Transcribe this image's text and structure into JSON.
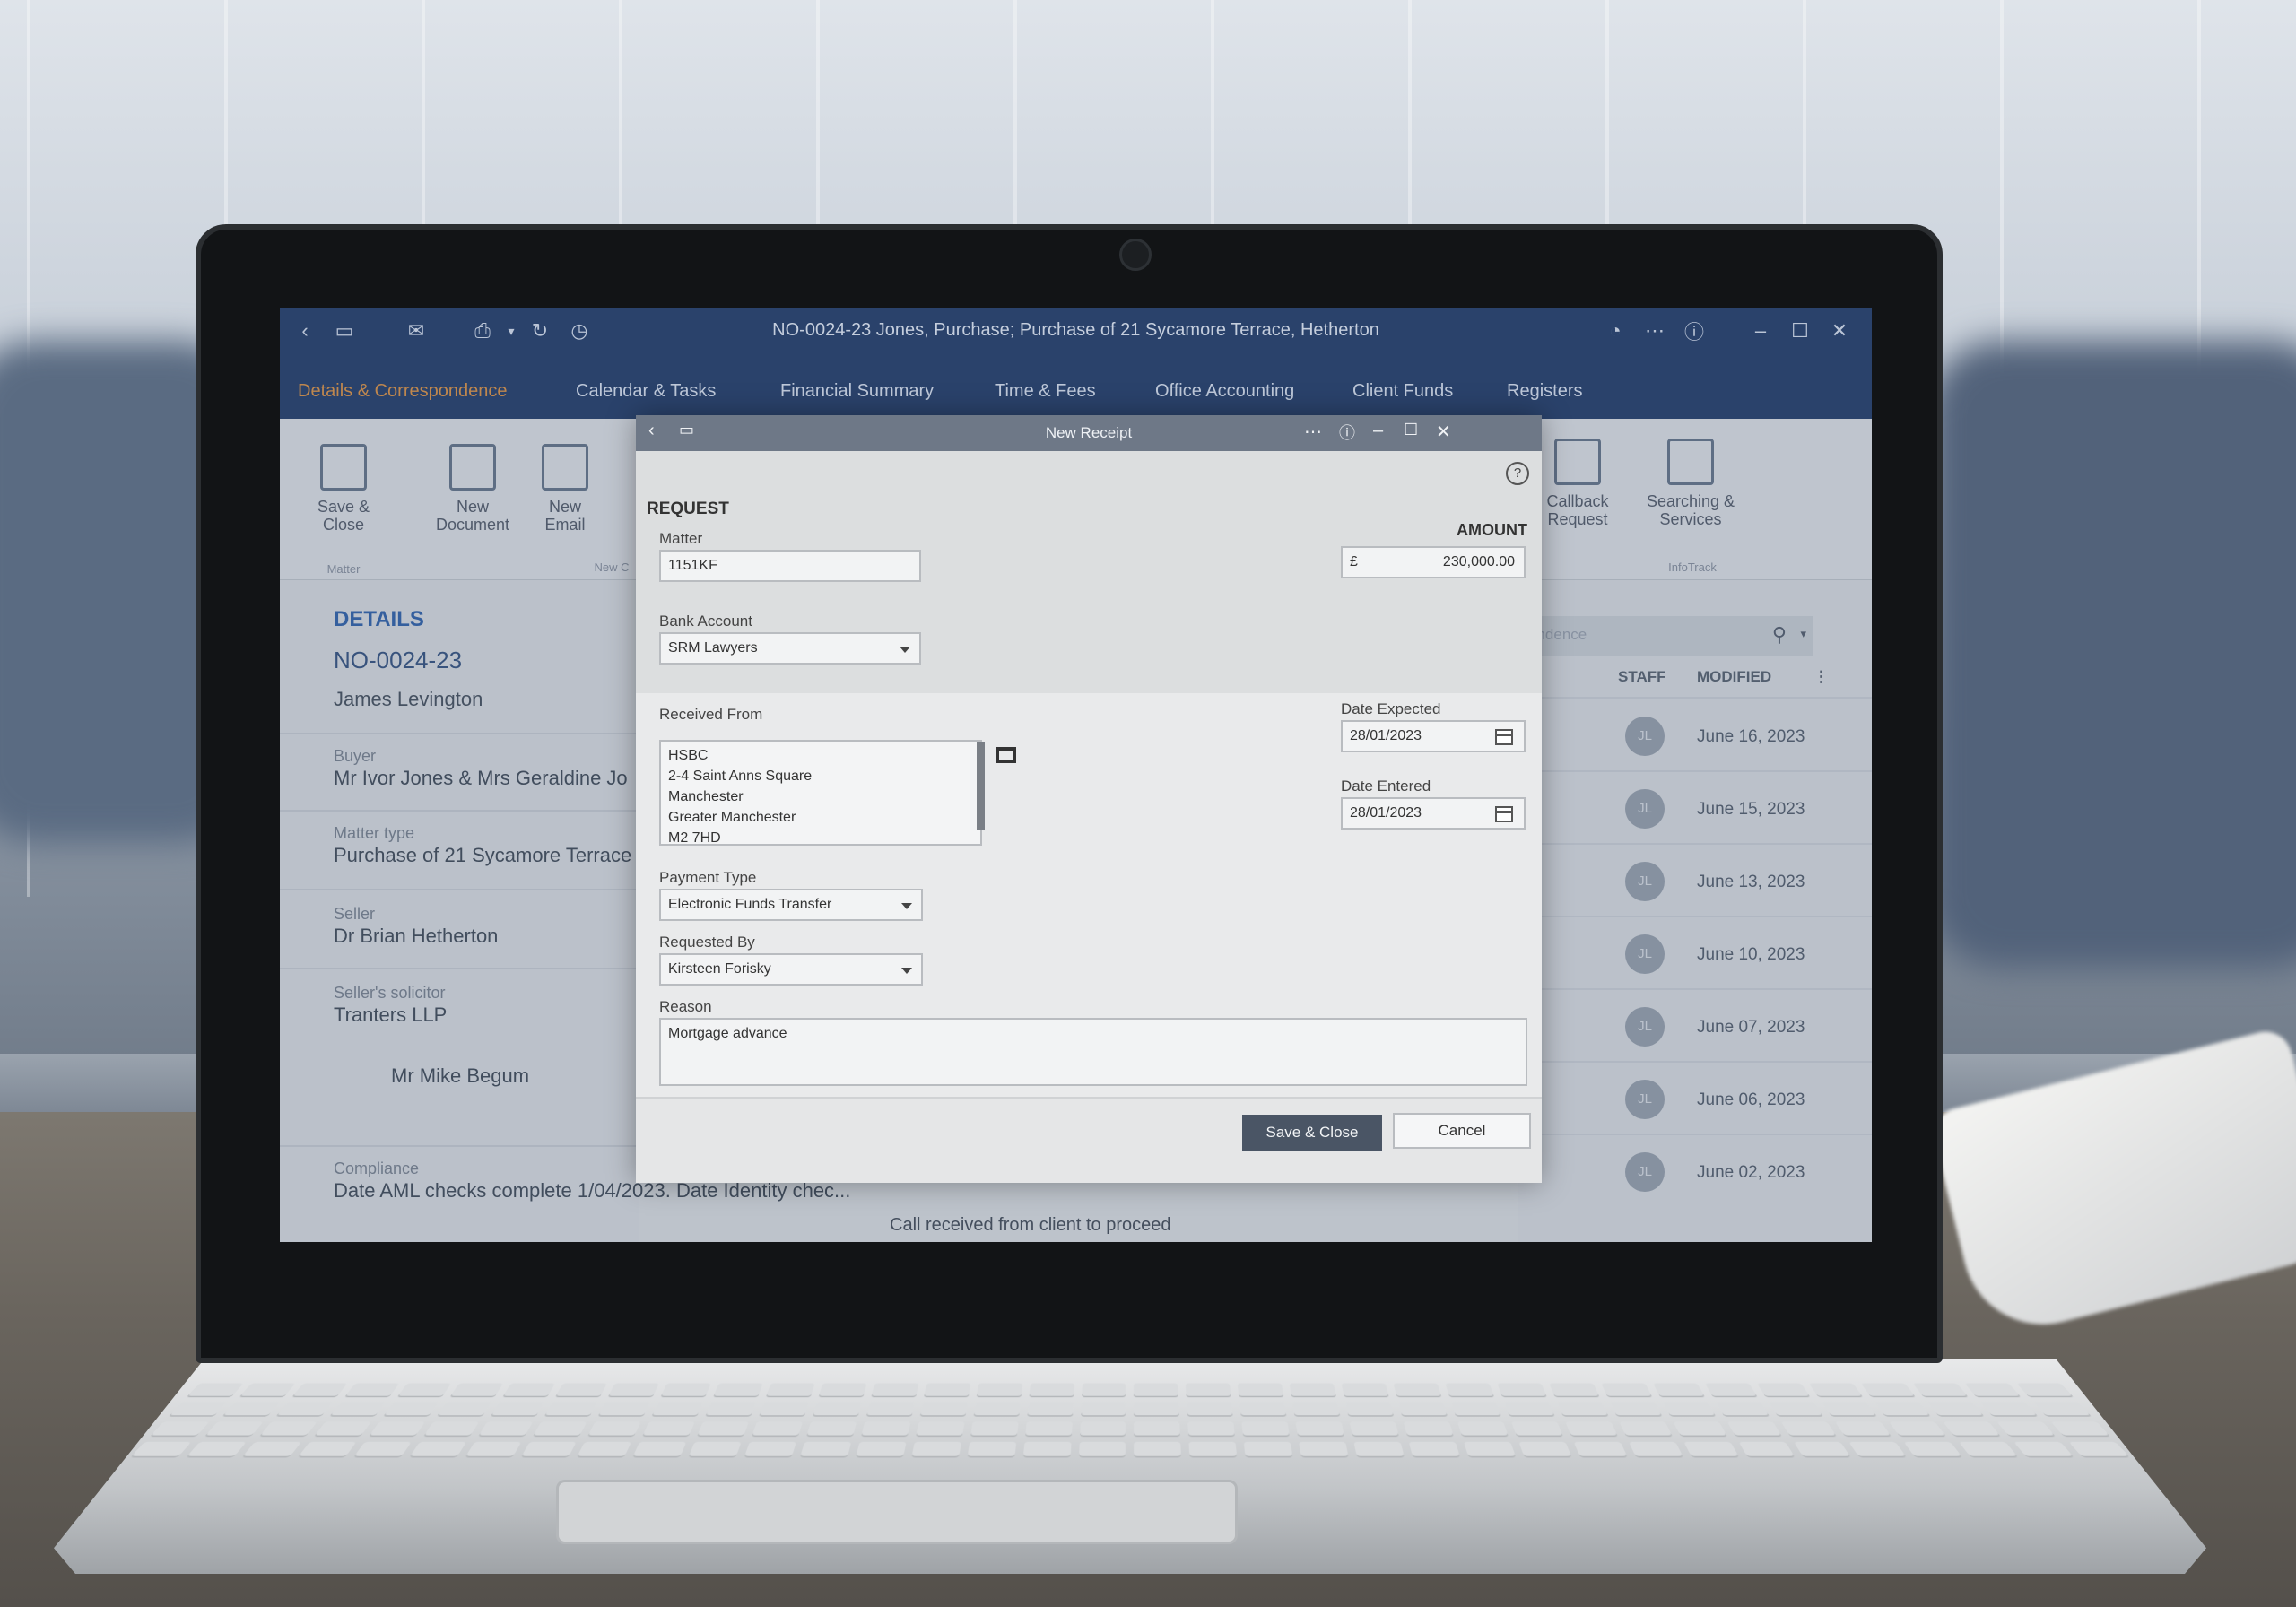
{
  "window": {
    "title": "NO-0024-23 Jones, Purchase; Purchase of 21 Sycamore Terrace, Hetherton"
  },
  "nav_tabs": [
    {
      "label": "Details & Correspondence",
      "active": true
    },
    {
      "label": "Calendar & Tasks"
    },
    {
      "label": "Financial Summary"
    },
    {
      "label": "Time & Fees"
    },
    {
      "label": "Office Accounting"
    },
    {
      "label": "Client Funds"
    },
    {
      "label": "Registers"
    }
  ],
  "ribbon": {
    "save_close": "Save &\nClose",
    "new_document": "New\nDocument",
    "new_email": "New\nEmail",
    "group_matter": "Matter",
    "group_new": "New C",
    "callback_request": "Callback\nRequest",
    "searching_services": "Searching &\nServices",
    "group_infotrack": "InfoTrack"
  },
  "details": {
    "heading": "DETAILS",
    "matter_number": "NO-0024-23",
    "fee_earner": "James Levington",
    "buyer_label": "Buyer",
    "buyer": "Mr Ivor Jones & Mrs Geraldine Jo",
    "matter_type_label": "Matter type",
    "matter_type": "Purchase of 21 Sycamore Terrace",
    "seller_label": "Seller",
    "seller": "Dr Brian Hetherton",
    "sellers_solicitor_label": "Seller's solicitor",
    "sellers_solicitor": "Tranters LLP",
    "contact": "Mr Mike Begum",
    "compliance_label": "Compliance",
    "compliance": "Date AML checks complete 1/04/2023. Date Identity chec..."
  },
  "correspondence": {
    "search_placeholder": "ondence",
    "col_staff": "STAFF",
    "col_modified": "MODIFIED",
    "rows": [
      {
        "staff": "JL",
        "modified": "June 16, 2023"
      },
      {
        "staff": "JL",
        "modified": "June 15, 2023"
      },
      {
        "staff": "JL",
        "modified": "June 13, 2023"
      },
      {
        "staff": "JL",
        "modified": "June 10, 2023"
      },
      {
        "staff": "JL",
        "modified": "June 07, 2023"
      },
      {
        "staff": "JL",
        "modified": "June 06, 2023"
      },
      {
        "staff": "JL",
        "modified": "June 02, 2023"
      }
    ],
    "bottom_text": "Call received from client to proceed"
  },
  "dialog": {
    "title": "New Receipt",
    "section": "REQUEST",
    "matter_label": "Matter",
    "matter_value": "1151KF",
    "amount_label": "AMOUNT",
    "currency": "£",
    "amount_value": "230,000.00",
    "bank_account_label": "Bank Account",
    "bank_account_value": "SRM Lawyers",
    "received_from_label": "Received From",
    "received_from_lines": [
      "HSBC",
      "2-4 Saint Anns Square",
      "Manchester",
      "Greater Manchester",
      "M2 7HD"
    ],
    "date_expected_label": "Date Expected",
    "date_expected_value": "28/01/2023",
    "date_entered_label": "Date Entered",
    "date_entered_value": "28/01/2023",
    "payment_type_label": "Payment Type",
    "payment_type_value": "Electronic Funds Transfer",
    "requested_by_label": "Requested By",
    "requested_by_value": "Kirsteen Forisky",
    "reason_label": "Reason",
    "reason_value": "Mortgage advance",
    "save_close": "Save & Close",
    "cancel": "Cancel"
  },
  "colors": {
    "titlebar": "#1f3a66",
    "active_tab": "#c98845",
    "primary_button": "#4a5565"
  }
}
